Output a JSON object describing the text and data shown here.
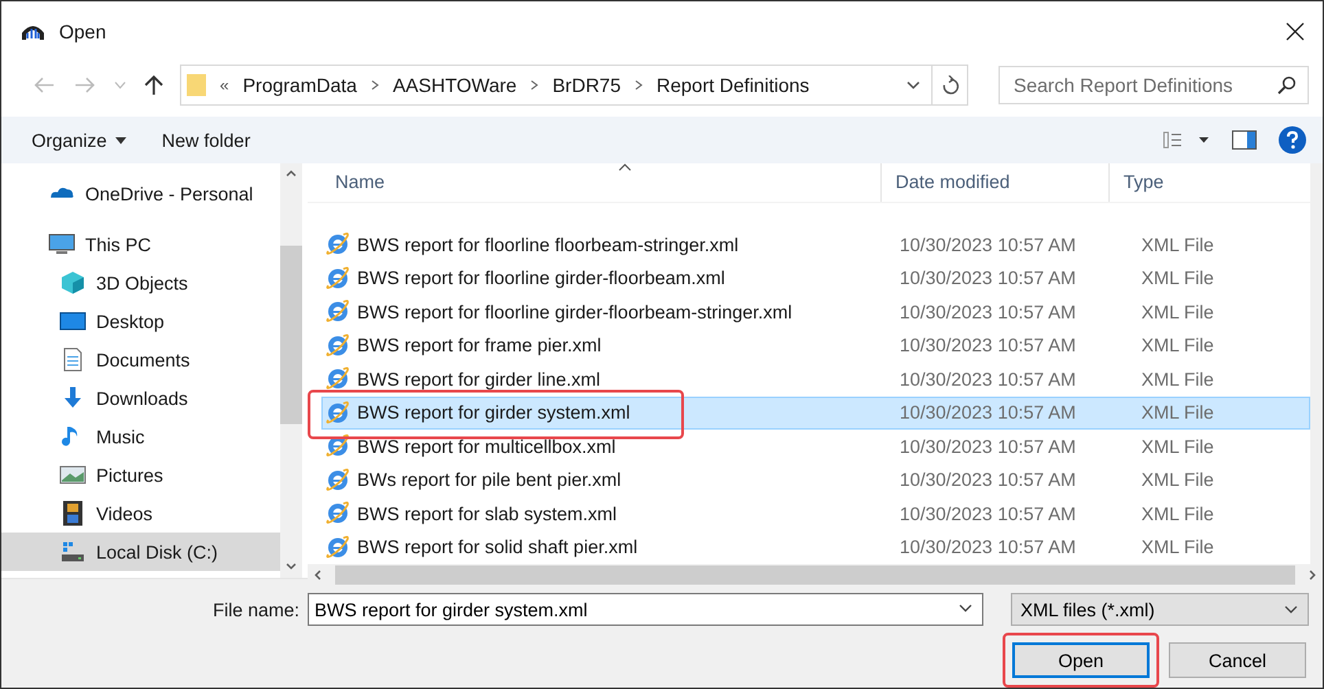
{
  "window": {
    "title": "Open"
  },
  "address": {
    "overflow": "«",
    "crumbs": [
      "ProgramData",
      "AASHTOWare",
      "BrDR75",
      "Report Definitions"
    ]
  },
  "search": {
    "placeholder": "Search Report Definitions"
  },
  "toolbar": {
    "organize": "Organize",
    "new_folder": "New folder"
  },
  "nav": [
    {
      "label": "OneDrive - Personal",
      "selected": false
    },
    {
      "label": "This PC",
      "selected": false,
      "children": [
        {
          "label": "3D Objects",
          "selected": false
        },
        {
          "label": "Desktop",
          "selected": false
        },
        {
          "label": "Documents",
          "selected": false
        },
        {
          "label": "Downloads",
          "selected": false
        },
        {
          "label": "Music",
          "selected": false
        },
        {
          "label": "Pictures",
          "selected": false
        },
        {
          "label": "Videos",
          "selected": false
        },
        {
          "label": "Local Disk (C:)",
          "selected": true
        }
      ]
    }
  ],
  "columns": [
    "Name",
    "Date modified",
    "Type"
  ],
  "files": [
    {
      "name": "BWS report for floorline floorbeam-stringer.xml",
      "date": "10/30/2023 10:57 AM",
      "type": "XML File",
      "selected": false,
      "highlighted": false
    },
    {
      "name": "BWS report for floorline girder-floorbeam.xml",
      "date": "10/30/2023 10:57 AM",
      "type": "XML File",
      "selected": false,
      "highlighted": false
    },
    {
      "name": "BWS report for floorline girder-floorbeam-stringer.xml",
      "date": "10/30/2023 10:57 AM",
      "type": "XML File",
      "selected": false,
      "highlighted": false
    },
    {
      "name": "BWS report for frame pier.xml",
      "date": "10/30/2023 10:57 AM",
      "type": "XML File",
      "selected": false,
      "highlighted": false
    },
    {
      "name": "BWS report for girder line.xml",
      "date": "10/30/2023 10:57 AM",
      "type": "XML File",
      "selected": false,
      "highlighted": false
    },
    {
      "name": "BWS report for girder system.xml",
      "date": "10/30/2023 10:57 AM",
      "type": "XML File",
      "selected": true,
      "highlighted": true
    },
    {
      "name": "BWS report for multicellbox.xml",
      "date": "10/30/2023 10:57 AM",
      "type": "XML File",
      "selected": false,
      "highlighted": false
    },
    {
      "name": "BWs report for pile bent pier.xml",
      "date": "10/30/2023 10:57 AM",
      "type": "XML File",
      "selected": false,
      "highlighted": false
    },
    {
      "name": "BWS report for slab system.xml",
      "date": "10/30/2023 10:57 AM",
      "type": "XML File",
      "selected": false,
      "highlighted": false
    },
    {
      "name": "BWS report for solid shaft pier.xml",
      "date": "10/30/2023 10:57 AM",
      "type": "XML File",
      "selected": false,
      "highlighted": false
    }
  ],
  "file_name": {
    "label": "File name:",
    "value": "BWS report for girder system.xml"
  },
  "file_type": {
    "value": "XML files (*.xml)"
  },
  "buttons": [
    {
      "label": "Open",
      "default": true,
      "highlighted": true
    },
    {
      "label": "Cancel",
      "default": false,
      "highlighted": false
    }
  ]
}
